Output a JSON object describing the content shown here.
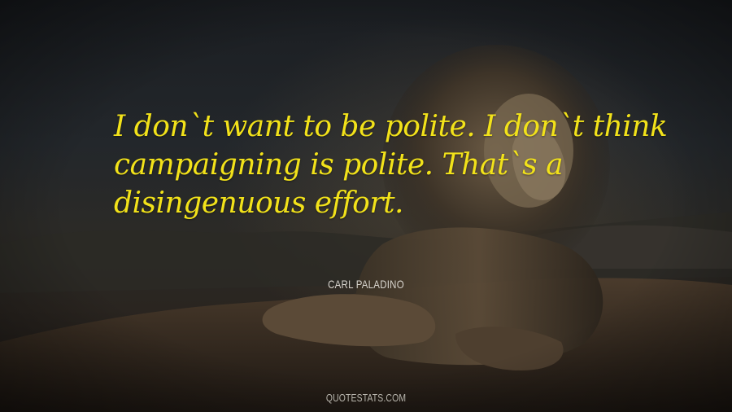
{
  "quote": {
    "lines": [
      "I don`t want to be polite. I don`t think",
      "campaigning is polite. That`s a",
      "disingenuous effort."
    ],
    "color": "#f2e21a"
  },
  "author": "CARL PALADINO",
  "watermark": "QUOTESTATS.COM",
  "background": {
    "subject": "lion-resting-on-rock",
    "palette": [
      "#1b1e22",
      "#2b2a27",
      "#5a4a36"
    ]
  }
}
